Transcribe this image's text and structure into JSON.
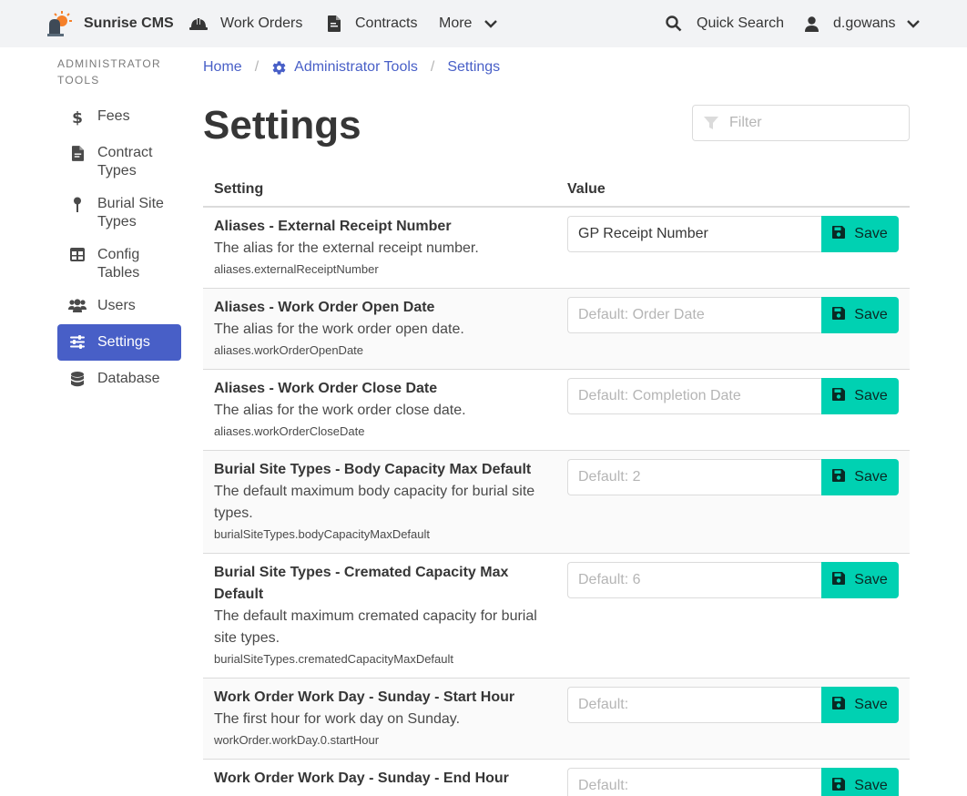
{
  "navbar": {
    "brand": "Sunrise CMS",
    "work_orders": "Work Orders",
    "contracts": "Contracts",
    "more": "More",
    "quick_search": "Quick Search",
    "user": "d.gowans"
  },
  "sidebar": {
    "label": "Administrator Tools",
    "items": [
      {
        "label": "Fees",
        "icon": "dollar-icon"
      },
      {
        "label": "Contract Types",
        "icon": "file-contract-icon"
      },
      {
        "label": "Burial Site Types",
        "icon": "map-pin-icon"
      },
      {
        "label": "Config Tables",
        "icon": "table-icon"
      },
      {
        "label": "Users",
        "icon": "users-icon"
      },
      {
        "label": "Settings",
        "icon": "sliders-icon"
      },
      {
        "label": "Database",
        "icon": "database-icon"
      }
    ]
  },
  "breadcrumb": {
    "home": "Home",
    "admin": "Administrator Tools",
    "current": "Settings"
  },
  "page": {
    "title": "Settings",
    "filter_placeholder": "Filter"
  },
  "table": {
    "col_setting": "Setting",
    "col_value": "Value",
    "save_label": "Save",
    "rows": [
      {
        "name": "Aliases - External Receipt Number",
        "desc": "The alias for the external receipt number.",
        "key": "aliases.externalReceiptNumber",
        "value": "GP Receipt Number",
        "placeholder": ""
      },
      {
        "name": "Aliases - Work Order Open Date",
        "desc": "The alias for the work order open date.",
        "key": "aliases.workOrderOpenDate",
        "value": "",
        "placeholder": "Default: Order Date"
      },
      {
        "name": "Aliases - Work Order Close Date",
        "desc": "The alias for the work order close date.",
        "key": "aliases.workOrderCloseDate",
        "value": "",
        "placeholder": "Default: Completion Date"
      },
      {
        "name": "Burial Site Types - Body Capacity Max Default",
        "desc": "The default maximum body capacity for burial site types.",
        "key": "burialSiteTypes.bodyCapacityMaxDefault",
        "value": "",
        "placeholder": "Default: 2"
      },
      {
        "name": "Burial Site Types - Cremated Capacity Max Default",
        "desc": "The default maximum cremated capacity for burial site types.",
        "key": "burialSiteTypes.crematedCapacityMaxDefault",
        "value": "",
        "placeholder": "Default: 6"
      },
      {
        "name": "Work Order Work Day - Sunday - Start Hour",
        "desc": "The first hour for work day on Sunday.",
        "key": "workOrder.workDay.0.startHour",
        "value": "",
        "placeholder": "Default:"
      },
      {
        "name": "Work Order Work Day - Sunday - End Hour",
        "desc": "",
        "key": "",
        "value": "",
        "placeholder": "Default:"
      }
    ]
  },
  "colors": {
    "accent": "#485fc7",
    "save": "#00d1b2"
  }
}
